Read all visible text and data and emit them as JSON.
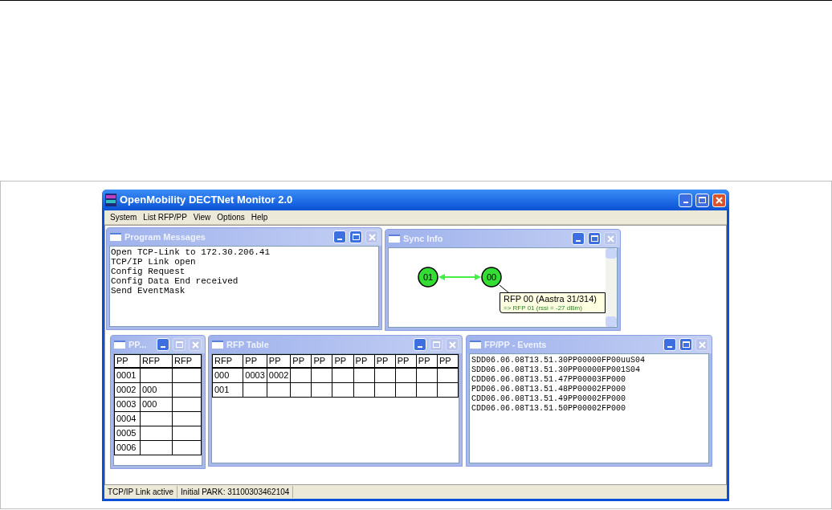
{
  "window": {
    "title": "OpenMobility DECTNet Monitor 2.0"
  },
  "menu": [
    "System",
    "List RFP/PP",
    "View",
    "Options",
    "Help"
  ],
  "program_messages": {
    "title": "Program Messages",
    "lines": [
      "Open TCP-Link to 172.30.206.41",
      "TCP/IP Link open",
      "Config Request",
      "Config Data End received",
      "Send EventMask"
    ]
  },
  "sync_info": {
    "title": "Sync Info",
    "nodes": [
      {
        "label": "01"
      },
      {
        "label": "00"
      }
    ],
    "tooltip": {
      "title": "RFP 00 (Aastra 31/314)",
      "detail": "=> RFP 01 (rssi = -27 dBm)"
    }
  },
  "pp_table": {
    "title": "PP...",
    "columns": [
      "PP",
      "RFP",
      "RFP"
    ],
    "rows": [
      [
        "0001",
        null,
        null
      ],
      [
        "0002",
        "000",
        null
      ],
      [
        "0003",
        "000",
        null
      ],
      [
        "0004",
        null,
        null
      ],
      [
        "0005",
        null,
        null
      ],
      [
        "0006",
        null,
        null
      ]
    ]
  },
  "rfp_table": {
    "title": "RFP Table",
    "columns": [
      "RFP",
      "PP",
      "PP",
      "PP",
      "PP",
      "PP",
      "PP",
      "PP",
      "PP",
      "PP",
      "PP"
    ],
    "rows": [
      [
        "000",
        "0003",
        "0002",
        null,
        null,
        null,
        null,
        null,
        null,
        null,
        null
      ],
      [
        "001",
        null,
        null,
        null,
        null,
        null,
        null,
        null,
        null,
        null,
        null
      ]
    ]
  },
  "events": {
    "title": "FP/PP - Events",
    "lines": [
      "SDD06.06.08T13.51.30PP00000FP00uuS04",
      "SDD06.06.08T13.51.30PP00000FP001S04",
      "CDD06.06.08T13.51.47PP00003FP000",
      "PDD06.06.08T13.51.48PP00002FP000",
      "CDD06.06.08T13.51.49PP00002FP000",
      "CDD06.06.08T13.51.50PP00002FP000"
    ]
  },
  "status_bar": [
    "TCP/IP Link active",
    "Initial PARK: 31100303462104"
  ]
}
